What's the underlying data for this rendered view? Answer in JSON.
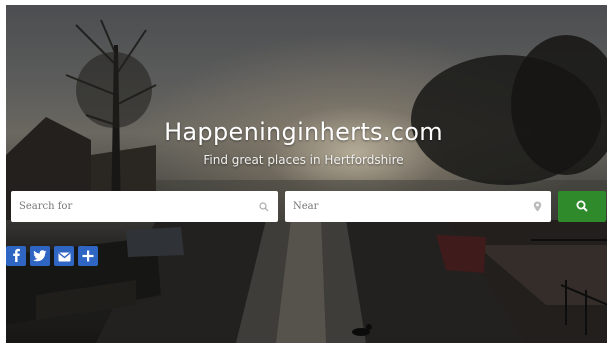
{
  "hero": {
    "site_title": "Happeninginherts.com",
    "tagline": "Find great places in Hertfordshire"
  },
  "search": {
    "what_placeholder": "Search for",
    "what_value": "",
    "near_placeholder": "Near",
    "near_value": "",
    "what_icon": "search-icon",
    "near_icon": "location-pin-icon",
    "button_icon": "search-icon"
  },
  "social": [
    {
      "name": "facebook",
      "icon": "facebook-icon"
    },
    {
      "name": "twitter",
      "icon": "twitter-icon"
    },
    {
      "name": "email",
      "icon": "email-icon"
    },
    {
      "name": "share",
      "icon": "plus-icon"
    }
  ],
  "colors": {
    "accent_green": "#2f8a2b",
    "social_blue": "#2f66c4",
    "title_text": "#ffffff"
  }
}
